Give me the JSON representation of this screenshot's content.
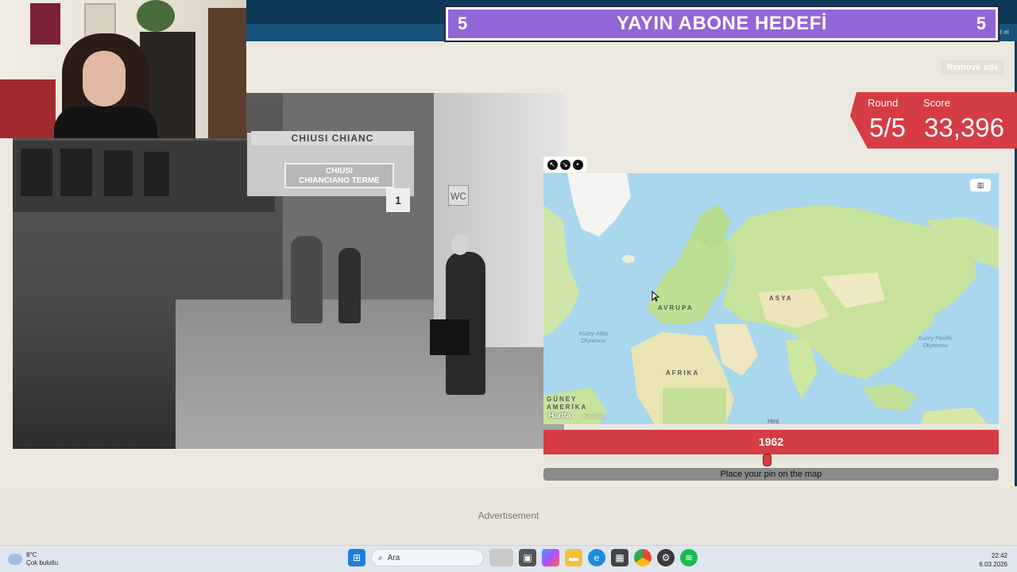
{
  "overlay": {
    "left_number": "5",
    "title": "YAYIN ABONE HEDEFİ",
    "right_number": "5"
  },
  "topbar": {
    "right_text": "pt et"
  },
  "game": {
    "remove_ads_label": "Remove ads",
    "round_label": "Round",
    "round_value": "5/5",
    "score_label": "Score",
    "score_value": "33,396",
    "photo_signs": {
      "station_sign": "CHIUSI CHIANC",
      "station_board": "CHIUSI\nCHIANCIANO TERME",
      "platform_number": "1",
      "wc_sign": "WC"
    },
    "map": {
      "labels": {
        "europe": "AVRUPA",
        "asia": "ASYA",
        "africa": "AFRIKA",
        "south_america": "GÜNEY AMERİKA",
        "india": "Hint"
      },
      "ocean_north_atlantic": "Kuzey Atlas Okyanusu",
      "ocean_north_pacific": "Kuzey Pasifik Okyanusu",
      "attribution": "Harita",
      "legal": "Yasal Bilgi",
      "type_button_icon": "map-icon",
      "tools": [
        "expand-icon",
        "shrink-icon",
        "pin-icon"
      ]
    },
    "year_value": "1962",
    "year_fraction": 0.49,
    "place_pin_label": "Place your pin on the map"
  },
  "advertisement_label": "Advertisement",
  "taskbar": {
    "weather_temp": "8°C",
    "weather_desc": "Çok bulutlu",
    "search_placeholder": "Ara",
    "time": "22:42",
    "date": "6.03.2026",
    "apps": [
      "windows-icon",
      "search-icon",
      "task-view-icon",
      "copilot-icon",
      "file-explorer-icon",
      "edge-icon",
      "store-icon",
      "chrome-icon",
      "app-icon",
      "spotify-icon"
    ]
  },
  "colors": {
    "accent_red": "#d63c43",
    "overlay_purple": "#9166d6",
    "topbar_navy": "#0f3a57"
  }
}
